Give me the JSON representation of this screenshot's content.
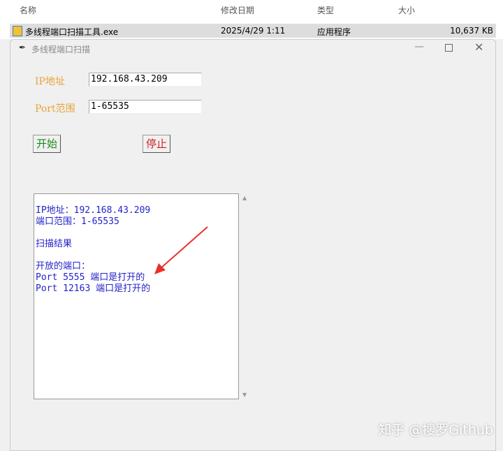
{
  "explorer": {
    "headers": [
      "名称",
      "修改日期",
      "类型",
      "大小"
    ],
    "file": {
      "name": "多线程端口扫描工具.exe",
      "date": "2025/4/29 1:11",
      "type": "应用程序",
      "size": "10,637 KB"
    }
  },
  "window": {
    "title": "多线程端口扫描"
  },
  "form": {
    "ip_label": "IP地址",
    "ip_value": "192.168.43.209",
    "port_label": "Port范围",
    "port_value": "1-65535",
    "start": "开始",
    "stop": "停止"
  },
  "output": {
    "lines": [
      "IP地址：192.168.43.209",
      "端口范围：1-65535",
      "",
      "扫描结果",
      "",
      "开放的端口：",
      "Port 5555 端口是打开的",
      "Port 12163 端口是打开的"
    ]
  },
  "watermark": "知乎 @搜罗Github"
}
